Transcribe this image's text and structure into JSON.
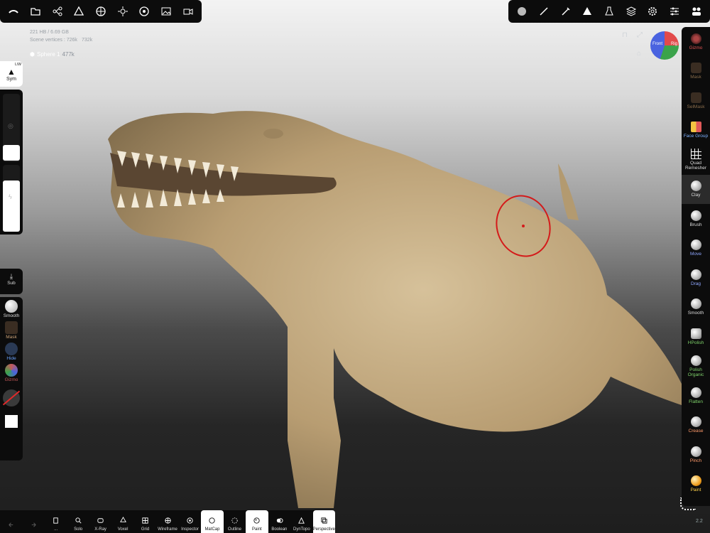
{
  "app": {
    "accent": "#ffffff",
    "bg": "#0c0c0c"
  },
  "top_left_toolbar": {
    "icons": [
      "scene-icon",
      "files-icon",
      "hierarchy-icon",
      "tools-icon",
      "background-icon",
      "lighting-icon",
      "postprocess-icon",
      "image-icon",
      "camera-icon"
    ]
  },
  "top_right_toolbar": {
    "icons": [
      "material-icon",
      "stroke-icon",
      "brush-settings-icon",
      "radius-icon",
      "filter-icon",
      "layers-icon",
      "settings-icon",
      "sliders-icon",
      "help-icon"
    ]
  },
  "info": {
    "mesh_stats": "221 HB / 6.69 GB",
    "scene_label": "Scene vertices : 726k",
    "scene_faces": "732k"
  },
  "mesh": {
    "name": "Sphere 1",
    "faces": "477k"
  },
  "navcube": {
    "front": "Front",
    "right": "Rig"
  },
  "left": {
    "sym_label": "Sym",
    "sym_mode": "L/W",
    "sub_label": "Sub",
    "tools": [
      {
        "label": "Smooth",
        "color": "#dddddd"
      },
      {
        "label": "Mask",
        "color": "#c9a176"
      },
      {
        "label": "Hide",
        "color": "#6aa3ff"
      },
      {
        "label": "Gizmo",
        "color": "#c55a5a"
      }
    ]
  },
  "right_tools": [
    {
      "label": "Gizmo",
      "color": "#e05555"
    },
    {
      "label": "Mask",
      "color": "#8a6d4b"
    },
    {
      "label": "SelMask",
      "color": "#8a6d4b"
    },
    {
      "label": "Face Group",
      "color": "#7fb2ff"
    },
    {
      "label": "Quad Remesher",
      "color": "#ffffff"
    },
    {
      "label": "Clay",
      "color": "#ffffff"
    },
    {
      "label": "Brush",
      "color": "#ffffff"
    },
    {
      "label": "Move",
      "color": "#8fa7ff"
    },
    {
      "label": "Drag",
      "color": "#8fa7ff"
    },
    {
      "label": "Smooth",
      "color": "#ffffff"
    },
    {
      "label": "HPolish",
      "color": "#7fd36b"
    },
    {
      "label": "Polish Organic",
      "color": "#7fd36b"
    },
    {
      "label": "Flatten",
      "color": "#7fd36b"
    },
    {
      "label": "Crease",
      "color": "#ff9a6a"
    },
    {
      "label": "Pinch",
      "color": "#ff9a6a"
    },
    {
      "label": "Paint",
      "color": "#ffd24a"
    }
  ],
  "bottom": {
    "items": [
      "",
      "",
      "...",
      "Solo",
      "X-Ray",
      "Voxel",
      "Grid",
      "Wireframe",
      "Inspector",
      "MatCap",
      "Outline",
      "Paint",
      "Boolean",
      "DynTopo",
      "Perspective"
    ],
    "active": [
      "MatCap",
      "Paint",
      "Perspective"
    ]
  },
  "version": "2.2"
}
